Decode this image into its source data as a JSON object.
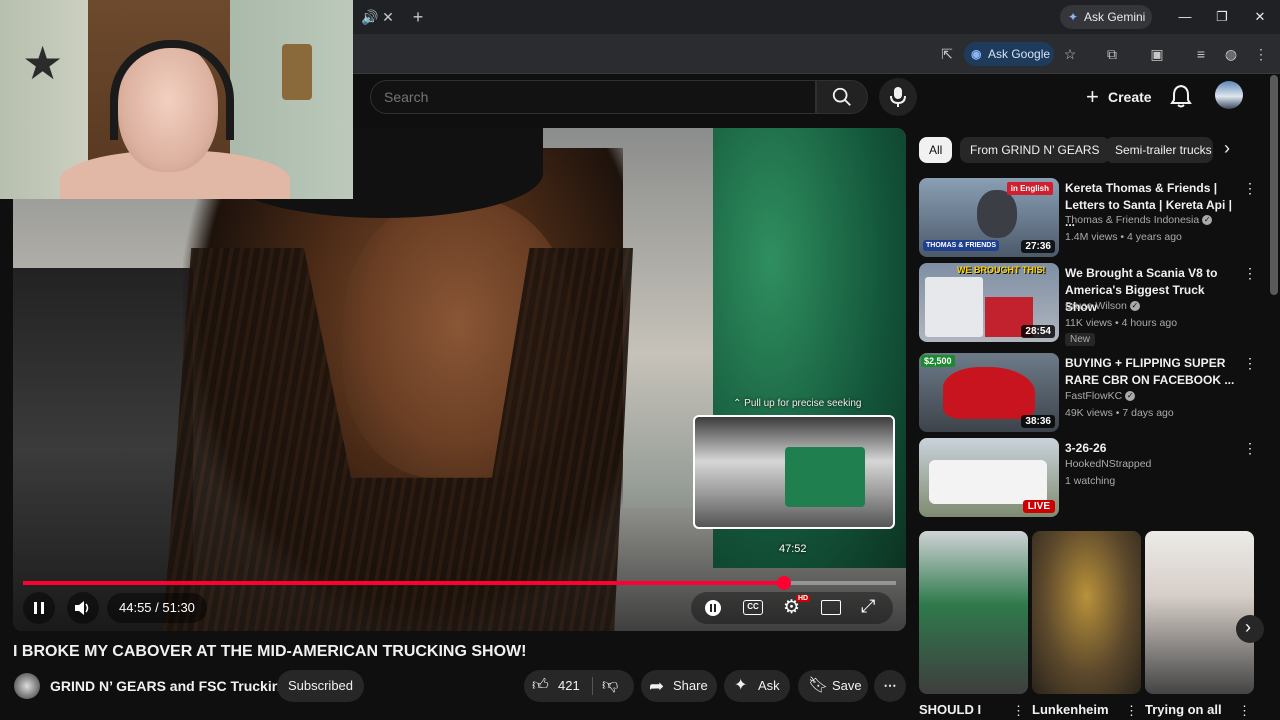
{
  "browser": {
    "gemini_label": "Ask Gemini",
    "ask_google_label": "Ask Google"
  },
  "header": {
    "search_placeholder": "Search",
    "create_label": "Create"
  },
  "player": {
    "seek_hint": "⌃ Pull up for precise seeking",
    "preview_time": "47:52",
    "time_display": "44:55 / 51:30",
    "progress_fraction": 0.872,
    "hd_badge": "HD"
  },
  "video": {
    "title": "I BROKE MY CABOVER AT THE MID-AMERICAN TRUCKING SHOW!",
    "channel": "GRIND N’ GEARS and FSC Trucking",
    "subscribed_label": "Subscribed",
    "like_count": "421",
    "share_label": "Share",
    "ask_label": "Ask",
    "save_label": "Save"
  },
  "chips": [
    {
      "label": "All"
    },
    {
      "label": "From GRIND N’ GEARS"
    },
    {
      "label": "Semi-trailer trucks"
    }
  ],
  "recommendations": [
    {
      "title": "Kereta Thomas & Friends | Letters to Santa | Kereta Api | ...",
      "channel": "Thomas & Friends Indonesia",
      "meta": "1.4M views • 4 years ago",
      "duration": "27:36",
      "thumb_text_1": "in English",
      "thumb_text_2": "THOMAS & FRIENDS"
    },
    {
      "title": "We Brought a Scania V8 to America's Biggest Truck Show",
      "channel": "Bruce Wilson",
      "meta": "11K views • 4 hours ago",
      "duration": "28:54",
      "badge": "New",
      "thumb_text_1": "WE BROUGHT THIS!"
    },
    {
      "title": "BUYING + FLIPPING SUPER RARE CBR ON FACEBOOK ...",
      "channel": "FastFlowKC",
      "meta": "49K views • 7 days ago",
      "duration": "38:36",
      "thumb_text_1": "$2,500"
    },
    {
      "title": "3-26-26",
      "channel": "HookedNStrapped",
      "meta": "1 watching",
      "live_label": "LIVE"
    }
  ],
  "shorts": [
    {
      "title": "SHOULD I"
    },
    {
      "title": "Lunkenheim"
    },
    {
      "title": "Trying on all"
    }
  ]
}
